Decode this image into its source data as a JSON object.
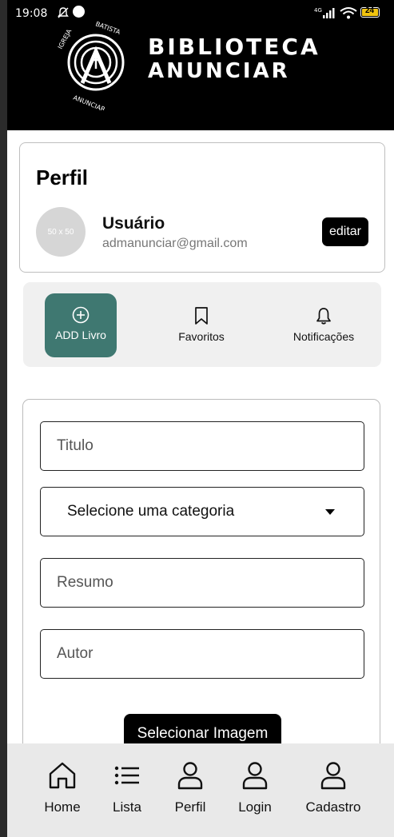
{
  "status_bar": {
    "time": "19:08",
    "battery": "24",
    "icons": [
      "notification-off-icon",
      "app-dot-icon",
      "signal-4g-icon",
      "wifi-icon",
      "battery-icon"
    ]
  },
  "header": {
    "brand_line1": "BIBLIOTECA",
    "brand_line2": "ANUNCIAR",
    "logo_text": "IGREJA BATISTA ANUNCIAR",
    "background": "#000000"
  },
  "profile": {
    "title": "Perfil",
    "avatar_placeholder": "50 x 50",
    "user_name": "Usuário",
    "email": "admanunciar@gmail.com",
    "edit_label": "editar"
  },
  "actions": [
    {
      "label": "ADD Livro",
      "icon": "plus-circle-icon",
      "active": true
    },
    {
      "label": "Favoritos",
      "icon": "bookmark-icon",
      "active": false
    },
    {
      "label": "Notificações",
      "icon": "bell-icon",
      "active": false
    }
  ],
  "form": {
    "title_placeholder": "Titulo",
    "category_selected": "Selecione uma categoria",
    "summary_placeholder": "Resumo",
    "author_placeholder": "Autor",
    "select_image_label": "Selecionar Imagem"
  },
  "bottom_nav": [
    {
      "label": "Home",
      "icon": "home-icon"
    },
    {
      "label": "Lista",
      "icon": "list-icon"
    },
    {
      "label": "Perfil",
      "icon": "user-icon"
    },
    {
      "label": "Login",
      "icon": "user-icon"
    },
    {
      "label": "Cadastro",
      "icon": "user-icon"
    }
  ],
  "colors": {
    "accent": "#3f7871",
    "button_dark": "#000000",
    "nav_background": "#e9e9e9"
  }
}
